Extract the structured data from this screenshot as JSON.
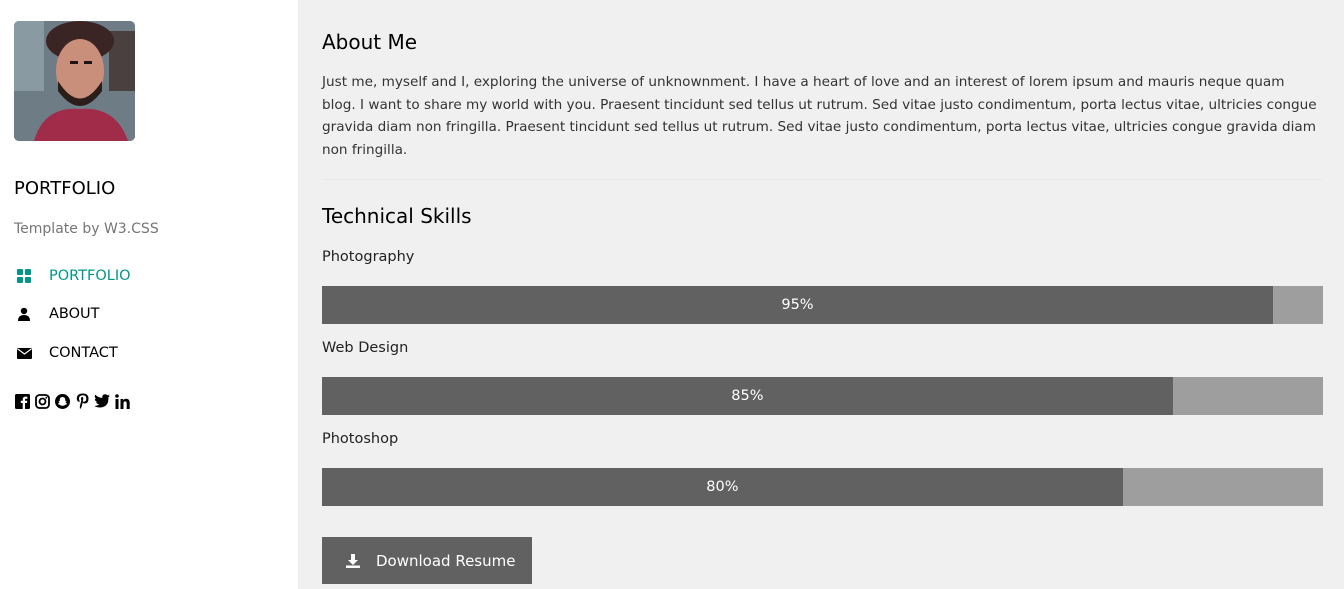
{
  "sidebar": {
    "brand": "PORTFOLIO",
    "tagline": "Template by W3.CSS",
    "nav": [
      {
        "label": "PORTFOLIO",
        "icon": "grid-icon",
        "active": true
      },
      {
        "label": "ABOUT",
        "icon": "user-icon",
        "active": false
      },
      {
        "label": "CONTACT",
        "icon": "envelope-icon",
        "active": false
      }
    ],
    "socials": [
      "facebook-icon",
      "instagram-icon",
      "snapchat-icon",
      "pinterest-icon",
      "twitter-icon",
      "linkedin-icon"
    ]
  },
  "main": {
    "about_title": "About Me",
    "about_text": "Just me, myself and I, exploring the universe of unknownment. I have a heart of love and an interest of lorem ipsum and mauris neque quam blog. I want to share my world with you. Praesent tincidunt sed tellus ut rutrum. Sed vitae justo condimentum, porta lectus vitae, ultricies congue gravida diam non fringilla. Praesent tincidunt sed tellus ut rutrum. Sed vitae justo condimentum, porta lectus vitae, ultricies congue gravida diam non fringilla.",
    "skills_title": "Technical Skills",
    "skills": [
      {
        "label": "Photography",
        "value": "95%",
        "percent": 95
      },
      {
        "label": "Web Design",
        "value": "85%",
        "percent": 85
      },
      {
        "label": "Photoshop",
        "value": "80%",
        "percent": 80
      }
    ],
    "download_label": "Download Resume"
  },
  "colors": {
    "accent": "#009688",
    "bar_fill": "#616161",
    "bar_track": "#9e9e9e",
    "main_bg": "#f0f0f0"
  }
}
